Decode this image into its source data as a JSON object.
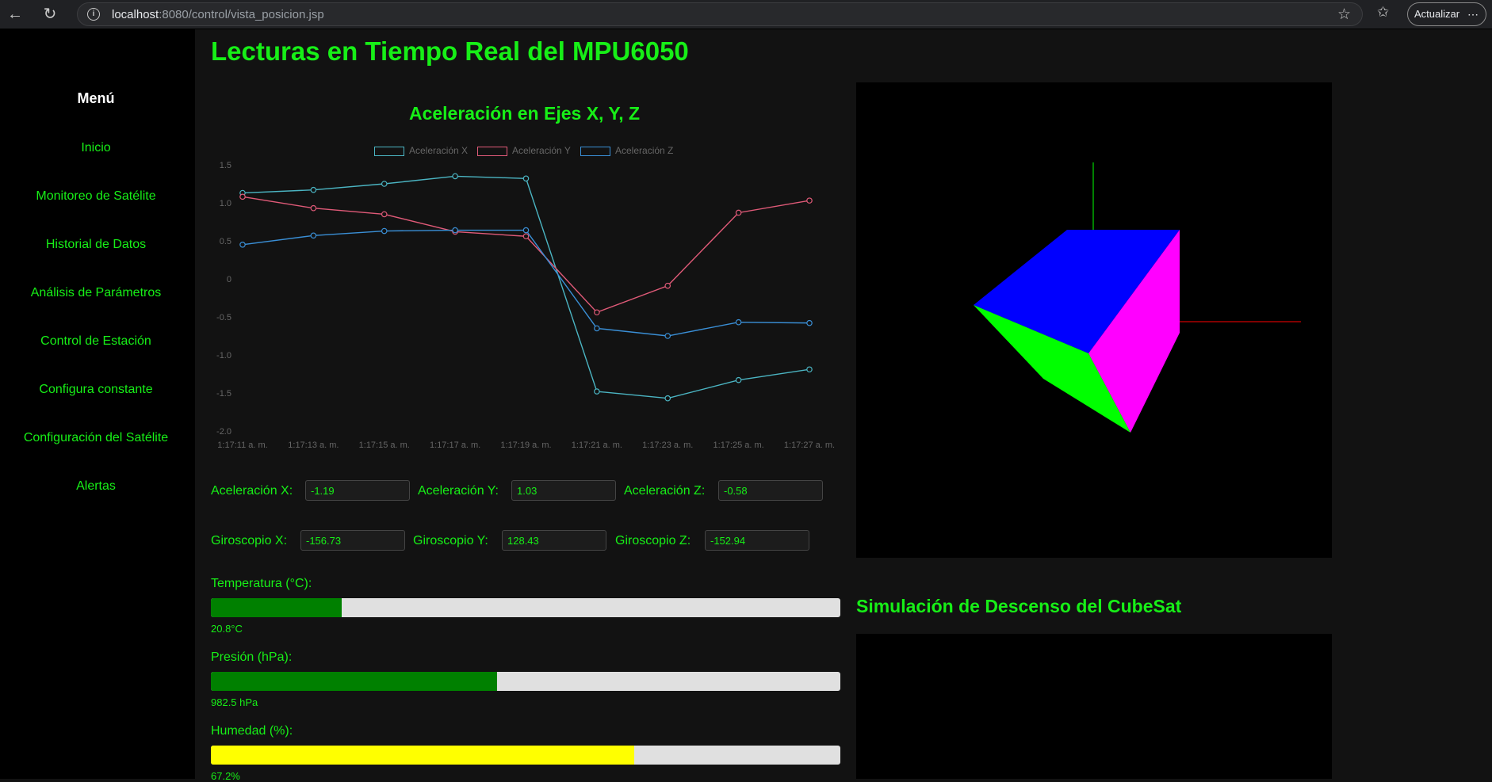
{
  "browser": {
    "url_host": "localhost",
    "url_rest": ":8080/control/vista_posicion.jsp",
    "update_label": "Actualizar"
  },
  "sidebar": {
    "title": "Menú",
    "items": [
      {
        "label": "Inicio"
      },
      {
        "label": "Monitoreo de Satélite"
      },
      {
        "label": "Historial de Datos"
      },
      {
        "label": "Análisis de Parámetros"
      },
      {
        "label": "Control de Estación"
      },
      {
        "label": "Configura constante"
      },
      {
        "label": "Configuración del Satélite"
      },
      {
        "label": "Alertas"
      }
    ]
  },
  "main": {
    "title": "Lecturas en Tiempo Real del MPU6050",
    "sim_title": "Simulación de Descenso del CubeSat"
  },
  "readings": {
    "accel": [
      {
        "label": "Aceleración X:",
        "value": "-1.19"
      },
      {
        "label": "Aceleración Y:",
        "value": "1.03"
      },
      {
        "label": "Aceleración Z:",
        "value": "-0.58"
      }
    ],
    "gyro": [
      {
        "label": "Giroscopio X:",
        "value": "-156.73"
      },
      {
        "label": "Giroscopio Y:",
        "value": "128.43"
      },
      {
        "label": "Giroscopio Z:",
        "value": "-152.94"
      }
    ]
  },
  "bars": [
    {
      "label": "Temperatura (°C):",
      "value_text": "20.8°C",
      "fraction": 0.208,
      "color": "#008000"
    },
    {
      "label": "Presión (hPa):",
      "value_text": "982.5 hPa",
      "fraction": 0.455,
      "color": "#008000"
    },
    {
      "label": "Humedad (%):",
      "value_text": "67.2%",
      "fraction": 0.672,
      "color": "#ffff00"
    }
  ],
  "colors": {
    "accent": "#17ef17",
    "series_x": "#4bb5c3",
    "series_y": "#e05a78",
    "series_z": "#3a8fd6",
    "cube_top": "#0000ff",
    "cube_right": "#ff00ff",
    "cube_left": "#00ff00"
  },
  "chart_data": {
    "type": "line",
    "title": "Aceleración en Ejes X, Y, Z",
    "categories": [
      "1:17:11 a. m.",
      "1:17:13 a. m.",
      "1:17:15 a. m.",
      "1:17:17 a. m.",
      "1:17:19 a. m.",
      "1:17:21 a. m.",
      "1:17:23 a. m.",
      "1:17:25 a. m.",
      "1:17:27 a. m."
    ],
    "series": [
      {
        "name": "Aceleración X",
        "values": [
          1.13,
          1.17,
          1.25,
          1.35,
          1.32,
          -1.48,
          -1.57,
          -1.33,
          -1.19
        ]
      },
      {
        "name": "Aceleración Y",
        "values": [
          1.08,
          0.93,
          0.85,
          0.62,
          0.56,
          -0.44,
          -0.09,
          0.87,
          1.03
        ]
      },
      {
        "name": "Aceleración Z",
        "values": [
          0.45,
          0.57,
          0.63,
          0.64,
          0.64,
          -0.65,
          -0.75,
          -0.57,
          -0.58
        ]
      }
    ],
    "yticks": [
      "1.5",
      "1.0",
      "0.5",
      "0",
      "-0.5",
      "-1.0",
      "-1.5",
      "-2.0"
    ],
    "ylim": [
      -2.0,
      1.5
    ],
    "legend": "top",
    "grid": false
  }
}
